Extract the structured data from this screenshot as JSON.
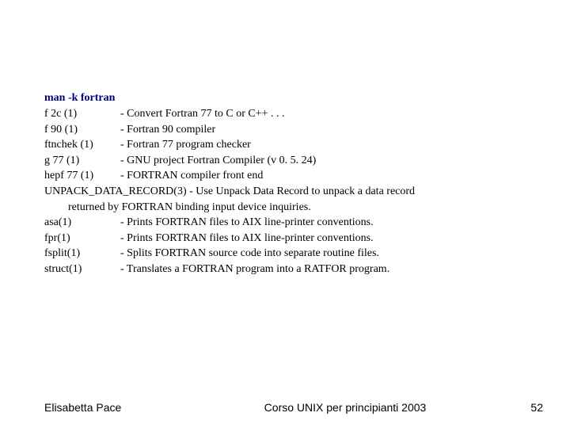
{
  "command": "man -k fortran",
  "entries": [
    {
      "name": "f 2c (1)",
      "desc": "- Convert Fortran 77 to C or C++ . . ."
    },
    {
      "name": "f 90 (1)",
      "desc": "- Fortran 90 compiler"
    },
    {
      "name": "ftnchek (1)",
      "desc": "- Fortran 77 program checker"
    },
    {
      "name": "g 77 (1)",
      "desc": "- GNU project Fortran Compiler (v 0. 5. 24)"
    },
    {
      "name": "hepf 77 (1)",
      "desc": "- FORTRAN compiler front end"
    }
  ],
  "wrapped": {
    "line1": "UNPACK_DATA_RECORD(3)   - Use Unpack Data Record to unpack a data record",
    "line2": "returned by FORTRAN binding input device inquiries."
  },
  "entries2": [
    {
      "name": "asa(1)",
      "desc": "- Prints FORTRAN files to AIX line-printer conventions."
    },
    {
      "name": "fpr(1)",
      "desc": "- Prints FORTRAN files to AIX line-printer conventions."
    },
    {
      "name": "fsplit(1)",
      "desc": " - Splits FORTRAN source code into separate routine files."
    },
    {
      "name": "struct(1)",
      "desc": "- Translates a FORTRAN program into a RATFOR program."
    }
  ],
  "footer": {
    "author": "Elisabetta Pace",
    "course": "Corso UNIX per principianti 2003",
    "page": "52"
  }
}
